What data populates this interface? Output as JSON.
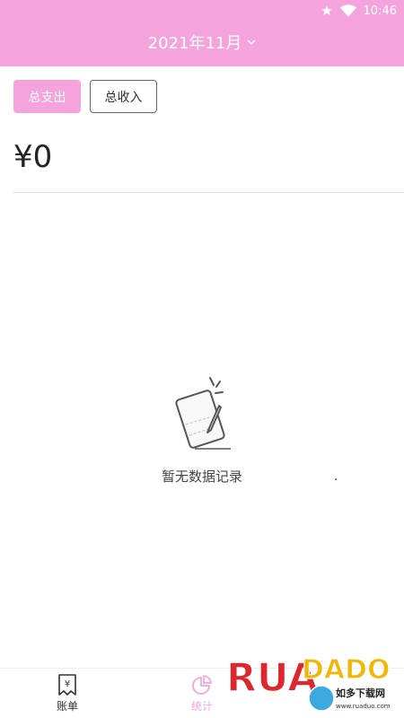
{
  "status_bar": {
    "time": "10:46"
  },
  "header": {
    "month_label": "2021年11月"
  },
  "tabs": [
    {
      "label": "总支出",
      "active": true
    },
    {
      "label": "总收入",
      "active": false
    }
  ],
  "summary": {
    "amount": "¥0"
  },
  "empty_state": {
    "message": "暂无数据记录"
  },
  "bottom_nav": [
    {
      "label": "账单",
      "icon": "bill-icon"
    },
    {
      "label": "统计",
      "icon": "pie-chart-icon",
      "active": true
    }
  ],
  "watermark": {
    "brand": "RUANDADO",
    "subtitle": "如多下载网",
    "url": "www.ruaduo.com"
  },
  "colors": {
    "accent": "#f4a3dd",
    "text": "#333333"
  }
}
